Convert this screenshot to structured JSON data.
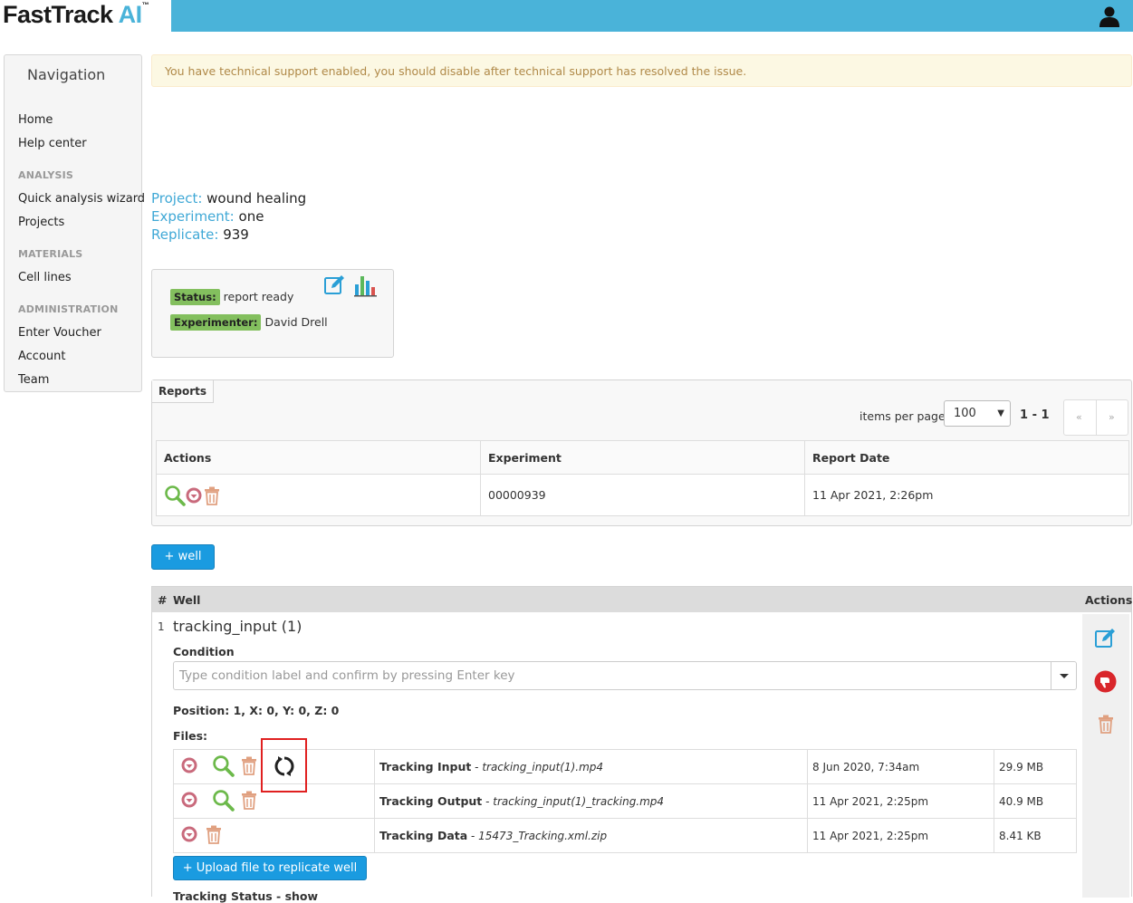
{
  "header": {
    "logo_main": "FastTrack",
    "logo_ai": "AI",
    "logo_tm": "™"
  },
  "sidebar": {
    "title": "Navigation",
    "items": [
      {
        "label": "Home"
      },
      {
        "label": "Help center"
      },
      {
        "heading": "ANALYSIS"
      },
      {
        "label": "Quick analysis wizard"
      },
      {
        "label": "Projects"
      },
      {
        "heading": "MATERIALS"
      },
      {
        "label": "Cell lines"
      },
      {
        "heading": "ADMINISTRATION"
      },
      {
        "label": "Enter Voucher"
      },
      {
        "label": "Account"
      },
      {
        "label": "Team"
      }
    ]
  },
  "alert": {
    "text": "You have technical support enabled, you should disable after technical support has resolved the issue."
  },
  "meta": {
    "project_label": "Project:",
    "project_value": "wound healing",
    "experiment_label": "Experiment:",
    "experiment_value": "one",
    "replicate_label": "Replicate:",
    "replicate_value": "939"
  },
  "status_card": {
    "status_label": "Status:",
    "status_value": "report ready",
    "experimenter_label": "Experimenter:",
    "experimenter_value": "David Drell",
    "icons": [
      "edit-icon",
      "chart-icon"
    ]
  },
  "reports": {
    "tab_label": "Reports",
    "items_per_page_label": "items per page:",
    "items_per_page_value": "100",
    "page_range": "1 - 1",
    "pager_prev": "«",
    "pager_next": "»",
    "columns": [
      "Actions",
      "Experiment",
      "Report Date"
    ],
    "rows": [
      {
        "experiment": "00000939",
        "report_date": "11 Apr 2021, 2:26pm"
      }
    ]
  },
  "add_well_button": "+ well",
  "wells": {
    "col_hash": "#",
    "col_well": "Well",
    "col_actions": "Actions",
    "items": [
      {
        "number": "1",
        "name": "tracking_input (1)",
        "condition_label": "Condition",
        "condition_placeholder": "Type condition label and confirm by pressing Enter key",
        "position": "Position: 1, X: 0, Y: 0, Z: 0",
        "files_label": "Files:",
        "files": [
          {
            "type": "Tracking Input",
            "sep": " - ",
            "name": "tracking_input(1).mp4",
            "date": "8 Jun 2020, 7:34am",
            "size": "29.9 MB"
          },
          {
            "type": "Tracking Output",
            "sep": " - ",
            "name": "tracking_input(1)_tracking.mp4",
            "date": "11 Apr 2021, 2:25pm",
            "size": "40.9 MB"
          },
          {
            "type": "Tracking Data",
            "sep": " - ",
            "name": "15473_Tracking.xml.zip",
            "date": "11 Apr 2021, 2:25pm",
            "size": "8.41 KB"
          }
        ],
        "upload_button": "+ Upload file to replicate well",
        "tracking_status": "Tracking Status - show"
      }
    ]
  },
  "colors": {
    "header_blue": "#4ab3d9",
    "label_green": "#83bf5e",
    "button_blue": "#1a9be0",
    "alert_bg": "#fcf8e3",
    "highlight_red": "#e02020"
  }
}
